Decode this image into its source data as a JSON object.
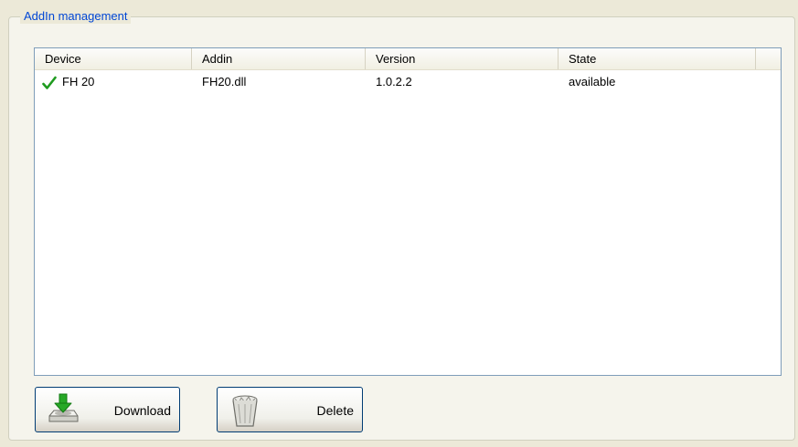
{
  "groupbox": {
    "title": "AddIn management"
  },
  "list": {
    "columns": [
      "Device",
      "Addin",
      "Version",
      "State"
    ],
    "rows": [
      {
        "device": "FH 20",
        "addin": "FH20.dll",
        "version": "1.0.2.2",
        "state": "available",
        "status_icon": "check-icon"
      }
    ]
  },
  "buttons": {
    "download": {
      "label": "Download",
      "icon": "download-icon"
    },
    "delete": {
      "label": "Delete",
      "icon": "trash-icon"
    }
  },
  "colors": {
    "title_blue": "#0046d5",
    "check_green": "#1f9b1f",
    "border_blue": "#7f9db9"
  }
}
